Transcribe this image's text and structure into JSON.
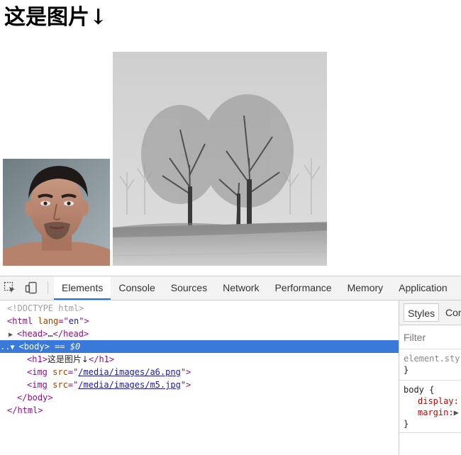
{
  "page": {
    "heading": "这是图片↓",
    "images": [
      {
        "name": "portrait-photo"
      },
      {
        "name": "landscape-trees-photo"
      }
    ]
  },
  "devtools": {
    "toolbar": {
      "inspect_icon": "cursor-inspect-icon",
      "device_icon": "device-toggle-icon",
      "tabs": [
        "Elements",
        "Console",
        "Sources",
        "Network",
        "Performance",
        "Memory",
        "Application"
      ],
      "active_tab": "Elements"
    },
    "dom": {
      "doctype": "<!DOCTYPE html>",
      "html_open_tag": "html",
      "html_attr_name": "lang",
      "html_attr_value": "en",
      "head_tag": "head",
      "head_ellipsis": "…",
      "body_tag": "body",
      "body_marker": "== $0",
      "body_dots": "..",
      "h1_tag": "h1",
      "h1_text": "这是图片↓",
      "img_tag": "img",
      "img_attr": "src",
      "img1_src": "/media/images/a6.png",
      "img2_src": "/media/images/m5.jpg"
    },
    "styles": {
      "tabs": [
        "Styles",
        "Com"
      ],
      "filter_placeholder": "Filter",
      "element_style_selector": "element.sty",
      "close_brace": "}",
      "body_selector": "body {",
      "prop_display": "display:",
      "prop_margin": "margin:"
    }
  }
}
